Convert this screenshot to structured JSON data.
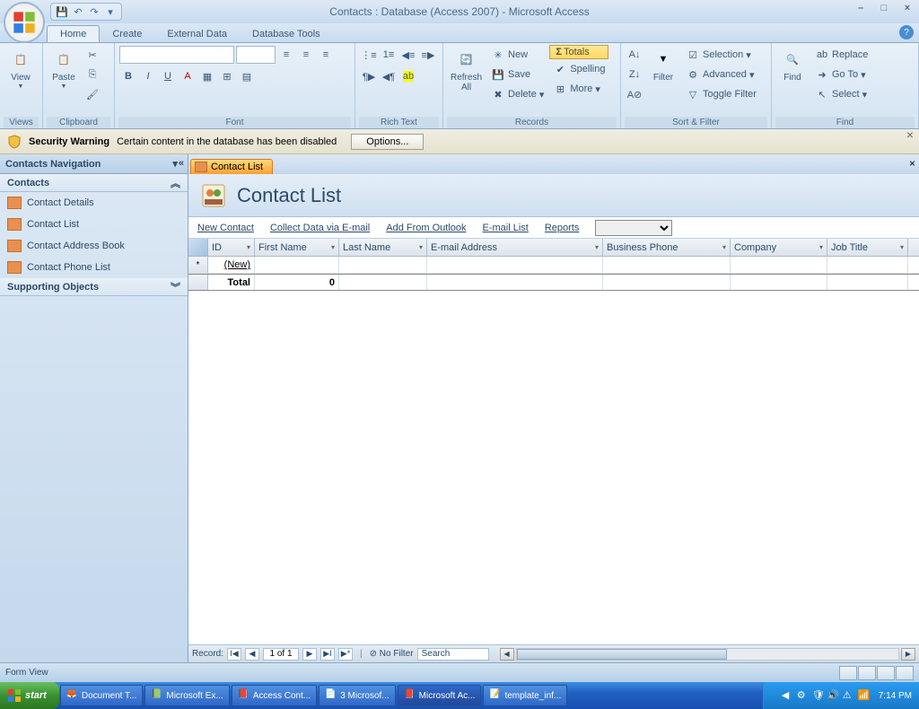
{
  "title": "Contacts : Database (Access 2007) - Microsoft Access",
  "tabs": {
    "home": "Home",
    "create": "Create",
    "external": "External Data",
    "dbtools": "Database Tools"
  },
  "ribbon": {
    "views": {
      "view": "View",
      "label": "Views"
    },
    "clipboard": {
      "paste": "Paste",
      "label": "Clipboard"
    },
    "font": {
      "label": "Font"
    },
    "richtext": {
      "label": "Rich Text"
    },
    "records": {
      "refresh": "Refresh\nAll",
      "new": "New",
      "save": "Save",
      "delete": "Delete",
      "totals": "Totals",
      "spelling": "Spelling",
      "more": "More",
      "label": "Records"
    },
    "sortfilter": {
      "filter": "Filter",
      "selection": "Selection",
      "advanced": "Advanced",
      "toggle": "Toggle Filter",
      "label": "Sort & Filter"
    },
    "find": {
      "find": "Find",
      "replace": "Replace",
      "goto": "Go To",
      "select": "Select",
      "label": "Find"
    }
  },
  "security": {
    "title": "Security Warning",
    "msg": "Certain content in the database has been disabled",
    "btn": "Options..."
  },
  "nav": {
    "header": "Contacts Navigation",
    "section1": "Contacts",
    "items": [
      "Contact Details",
      "Contact List",
      "Contact Address Book",
      "Contact Phone List"
    ],
    "section2": "Supporting Objects"
  },
  "doc": {
    "tab": "Contact List",
    "title": "Contact List",
    "links": {
      "new": "New Contact",
      "collect": "Collect Data via E-mail",
      "outlook": "Add From Outlook",
      "emaillist": "E-mail List",
      "reports": "Reports"
    },
    "cols": {
      "id": "ID",
      "fn": "First Name",
      "ln": "Last Name",
      "em": "E-mail Address",
      "bp": "Business Phone",
      "co": "Company",
      "jt": "Job Title"
    },
    "newrow": "(New)",
    "totalrow": {
      "label": "Total",
      "count": "0"
    }
  },
  "recnav": {
    "label": "Record:",
    "pos": "1 of 1",
    "nofilter": "No Filter",
    "search": "Search"
  },
  "status": "Form View",
  "taskbar": {
    "start": "start",
    "btns": [
      "Document T...",
      "Microsoft Ex...",
      "Access Cont...",
      "3 Microsof...",
      "Microsoft Ac...",
      "template_inf..."
    ],
    "clock": "7:14 PM"
  }
}
